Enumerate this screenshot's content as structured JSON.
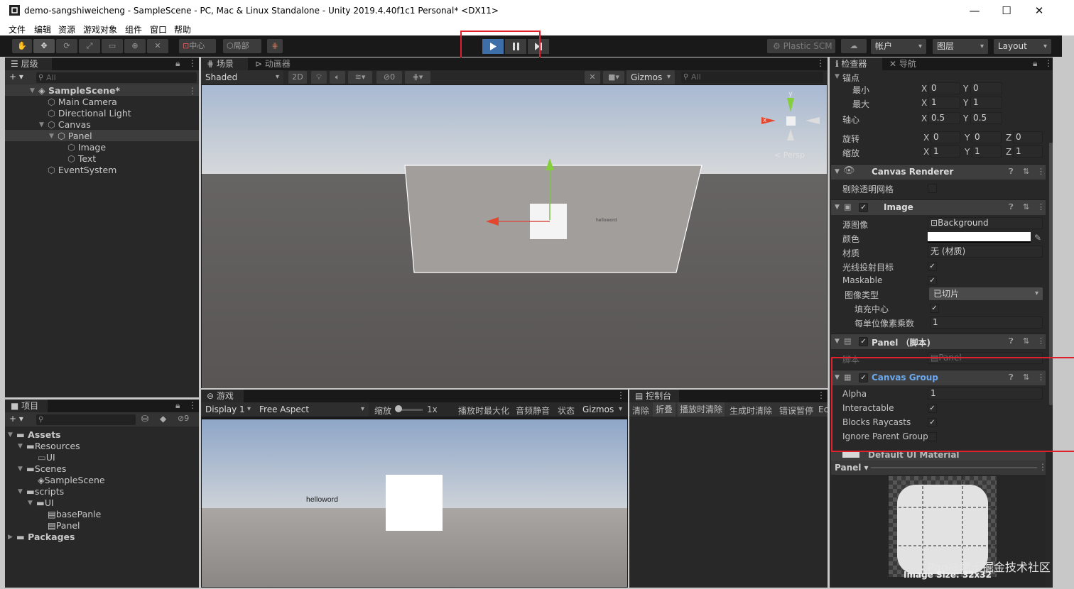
{
  "window": {
    "title": "demo-sangshiweicheng - SampleScene - PC, Mac & Linux Standalone - Unity 2019.4.40f1c1 Personal* <DX11>",
    "minimize": "—",
    "maximize": "☐",
    "close": "✕"
  },
  "menu": [
    "文件",
    "编辑",
    "资源",
    "游戏对象",
    "组件",
    "窗口",
    "帮助"
  ],
  "toolbar": {
    "pivot_center": "中心",
    "pivot_local": "局部",
    "plastic_scm": "Plastic SCM",
    "account": "帐户",
    "layers": "图层",
    "layout": "Layout",
    "play_state": "playing"
  },
  "hierarchy": {
    "tab": "层级",
    "add": "+ ▾",
    "search_placeholder": "All",
    "scene": "SampleScene*",
    "items": [
      "Main Camera",
      "Directional Light",
      "Canvas",
      "Panel",
      "Image",
      "Text",
      "EventSystem"
    ]
  },
  "scene": {
    "tab_scene": "场景",
    "tab_animator": "动画器",
    "shading": "Shaded",
    "mode_2d": "2D",
    "hidden_count": "0",
    "gizmos": "Gizmos",
    "search_placeholder": "All",
    "persp": "< Persp",
    "axis_y": "y",
    "axis_x": "x",
    "text_label": "helloword"
  },
  "game": {
    "tab": "游戏",
    "display": "Display 1",
    "aspect": "Free Aspect",
    "scale_label": "缩放",
    "scale_value": "1x",
    "maximize_on_play": "播放时最大化",
    "mute": "音频静音",
    "stats": "状态",
    "gizmos": "Gizmos",
    "text_label": "helloword"
  },
  "console": {
    "tab": "控制台",
    "buttons": [
      "清除",
      "折叠",
      "播放时清除",
      "生成时清除",
      "错误暂停",
      "Ec"
    ]
  },
  "project": {
    "tab": "项目",
    "add": "+ ▾",
    "hidden_count": "9",
    "tree": [
      "Assets",
      "Resources",
      "UI",
      "Scenes",
      "SampleScene",
      "scripts",
      "UI",
      "basePanle",
      "Panel",
      "Packages"
    ]
  },
  "inspector": {
    "tab": "检查器",
    "tab_nav": "导航",
    "anchors": "锚点",
    "min": "最小",
    "max": "最大",
    "pivot": "轴心",
    "rotation": "旋转",
    "scale": "缩放",
    "axis_x": "X",
    "axis_y": "Y",
    "axis_z": "Z",
    "min_x": "0",
    "min_y": "0",
    "max_x": "1",
    "max_y": "1",
    "pivot_x": "0.5",
    "pivot_y": "0.5",
    "rot_x": "0",
    "rot_y": "0",
    "rot_z": "0",
    "scale_x": "1",
    "scale_y": "1",
    "scale_z": "1",
    "canvas_renderer": "Canvas Renderer",
    "cull_transparent": "剔除透明网格",
    "image": "Image",
    "source_image_label": "源图像",
    "source_image": "Background",
    "color_label": "颜色",
    "material_label": "材质",
    "material": "无 (材质)",
    "raycast_target": "光线投射目标",
    "maskable": "Maskable",
    "image_type_label": "图像类型",
    "image_type": "已切片",
    "fill_center": "填充中心",
    "ppu_label": "每单位像素乘数",
    "ppu": "1",
    "panel_script": "Panel （脚本)",
    "script_label": "脚本",
    "script_value": "Panel",
    "canvas_group": "Canvas Group",
    "alpha_label": "Alpha",
    "alpha": "1",
    "interactable": "Interactable",
    "blocks_raycasts": "Blocks Raycasts",
    "ignore_parent_groups": "Ignore Parent Group",
    "default_material": "Default UI Material",
    "preview_name": "Panel",
    "image_size": "Image Size: 32x32",
    "watermark": "Pan@稀土掘金技术社区"
  },
  "colors": {
    "accent_blue": "#3d6ea8",
    "canvas_group_blue": "#6aa9f0",
    "highlight_red": "#e0202a"
  }
}
